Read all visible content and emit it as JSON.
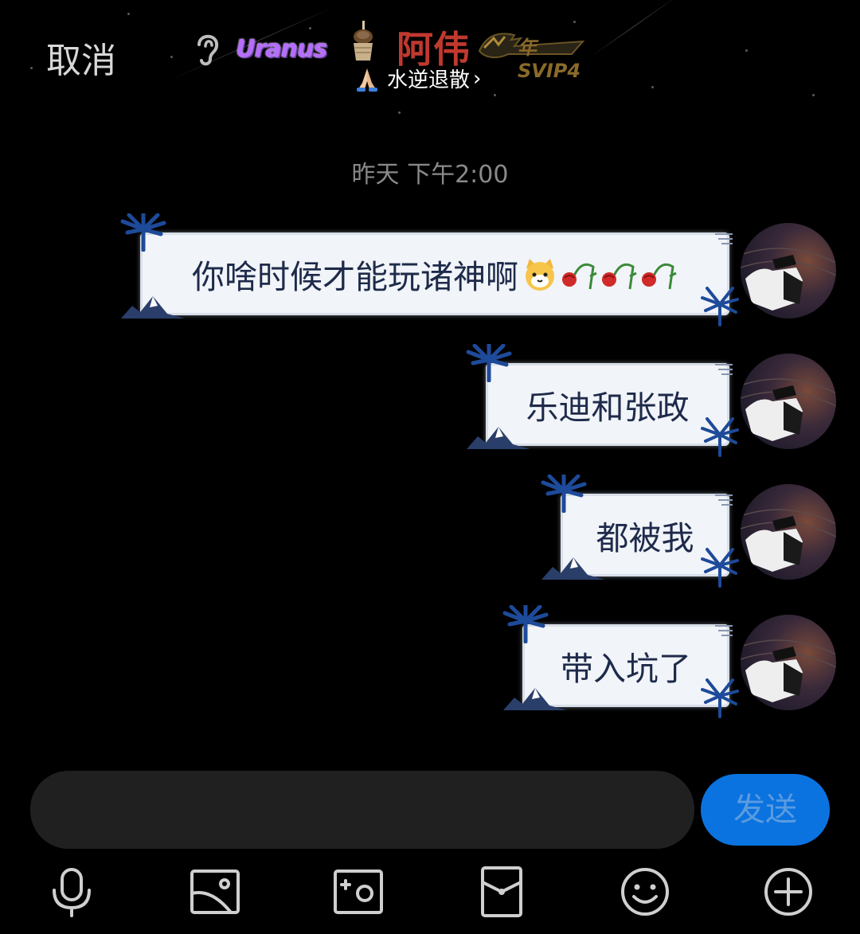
{
  "header": {
    "cancel_label": "取消",
    "badge_text": "Uranus",
    "contact_name": "阿伟",
    "vip_badge": "年SVIP4",
    "status_text": "水逆退散",
    "status_chevron": "›",
    "icons": [
      "ear-icon",
      "cake-icon",
      "vip-dragon-icon",
      "pray-icon"
    ]
  },
  "timestamp": "昨天 下午2:00",
  "messages": [
    {
      "text": "你啥时候才能玩诸神啊",
      "emoji": [
        "cat-face-icon",
        "wilted-rose-icon",
        "wilted-rose-icon",
        "wilted-rose-icon"
      ]
    },
    {
      "text": "乐迪和张政"
    },
    {
      "text": "都被我"
    },
    {
      "text": "带入坑了"
    }
  ],
  "composer": {
    "input_value": "",
    "send_label": "发送",
    "send_color": "#0a73e0"
  },
  "toolbar": [
    "microphone-icon",
    "image-icon",
    "camera-icon",
    "red-packet-icon",
    "emoji-icon",
    "plus-icon"
  ],
  "colors": {
    "background": "#000000",
    "name": "#c0392f",
    "bubble": "#f1f4f8",
    "bubble_text": "#1e2a4a",
    "accent": "#0a73e0"
  }
}
